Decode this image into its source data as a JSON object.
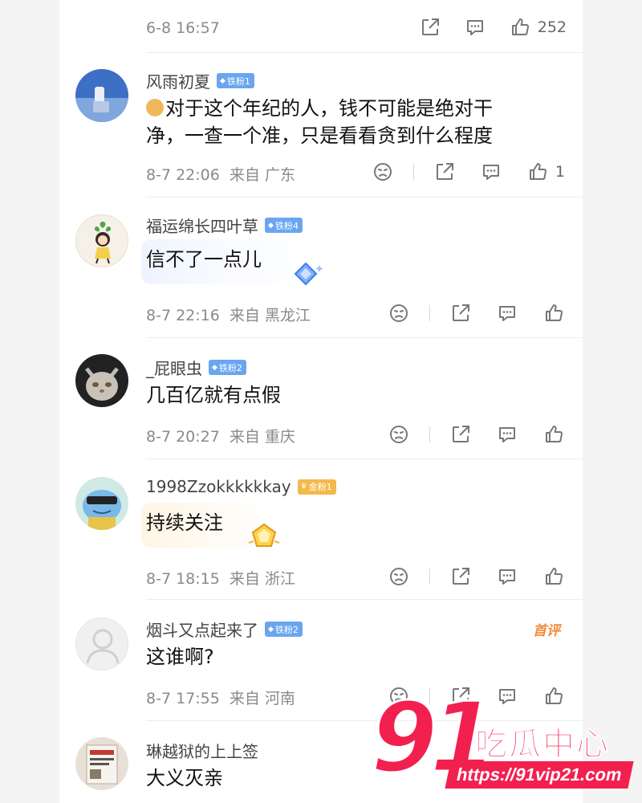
{
  "top": {
    "time": "6-8 16:57",
    "like_count": "252"
  },
  "comments": [
    {
      "name": "风雨初夏",
      "badge": "铁粉1",
      "text_lines": [
        "对于这个年纪的人，钱不可能是绝对干",
        "净，一查一个准，只是看看贪到什么程度"
      ],
      "time": "8-7 22:06",
      "location": "来自 广东",
      "likes": "1"
    },
    {
      "name": "福运绵长四叶草",
      "badge": "铁粉4",
      "text_lines": [
        "信不了一点儿"
      ],
      "time": "8-7 22:16",
      "location": "来自 黑龙江"
    },
    {
      "name": "_屁眼虫",
      "badge": "铁粉2",
      "text_lines": [
        "几百亿就有点假"
      ],
      "time": "8-7 20:27",
      "location": "来自 重庆"
    },
    {
      "name": "1998Zzokkkkkkay",
      "badge": "金粉1",
      "text_lines": [
        "持续关注"
      ],
      "time": "8-7 18:15",
      "location": "来自 浙江"
    },
    {
      "name": "烟斗又点起来了",
      "badge": "铁粉2",
      "tag": "首评",
      "text_lines": [
        "这谁啊?"
      ],
      "time": "8-7 17:55",
      "location": "来自 河南"
    },
    {
      "name": "琳越狱的上上签",
      "text_lines": [
        "大义灭亲"
      ]
    }
  ],
  "watermark": {
    "number": "91",
    "brand": "吃瓜中心",
    "url": "https://91vip21.com"
  },
  "colors": {
    "badge_iron": "#6aa6f0",
    "badge_gold": "#f3b94a",
    "watermark": "#f2204f",
    "first_tag": "#f08c3a"
  }
}
